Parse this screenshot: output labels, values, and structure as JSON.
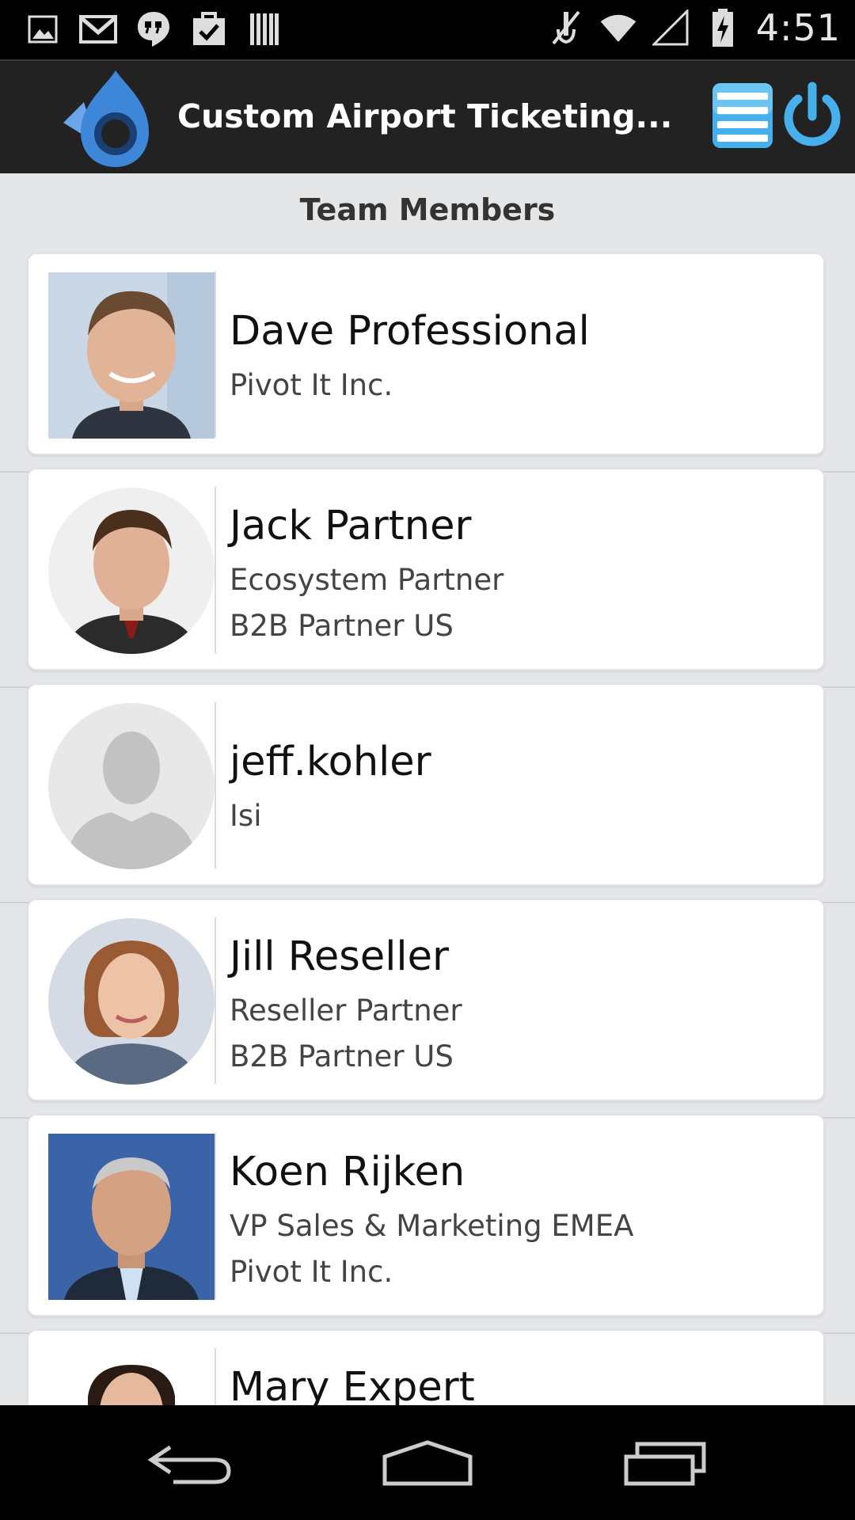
{
  "status_bar": {
    "time": "4:51",
    "left_icons": [
      "gallery-icon",
      "gmail-icon",
      "hangouts-icon",
      "tasks-icon",
      "barcode-icon"
    ],
    "right_icons": [
      "mute-icon",
      "wifi-icon",
      "signal-icon",
      "battery-icon"
    ]
  },
  "action_bar": {
    "title": "Custom Airport Ticketing...",
    "logo_color": "#3d86d8",
    "menu_icon": "menu-icon",
    "power_icon": "power-icon",
    "accent": "#45b0ec"
  },
  "section": {
    "title": "Team Members"
  },
  "members": [
    {
      "name": "Dave Professional",
      "line1": "Pivot It Inc.",
      "line2": "",
      "photo": "avatar-square"
    },
    {
      "name": "Jack Partner",
      "line1": "Ecosystem Partner",
      "line2": "B2B Partner US",
      "photo": "avatar-round"
    },
    {
      "name": "jeff.kohler",
      "line1": "Isi",
      "line2": "",
      "photo": "default-avatar"
    },
    {
      "name": "Jill Reseller",
      "line1": "Reseller Partner",
      "line2": "B2B Partner US",
      "photo": "avatar-round"
    },
    {
      "name": "Koen Rijken",
      "line1": "VP Sales & Marketing EMEA",
      "line2": "Pivot It Inc.",
      "photo": "avatar-square"
    },
    {
      "name": "Mary Expert",
      "line1": "",
      "line2": "",
      "photo": "avatar-square"
    }
  ],
  "nav_bar": {
    "icons": [
      "back-icon",
      "home-icon",
      "recents-icon"
    ]
  }
}
